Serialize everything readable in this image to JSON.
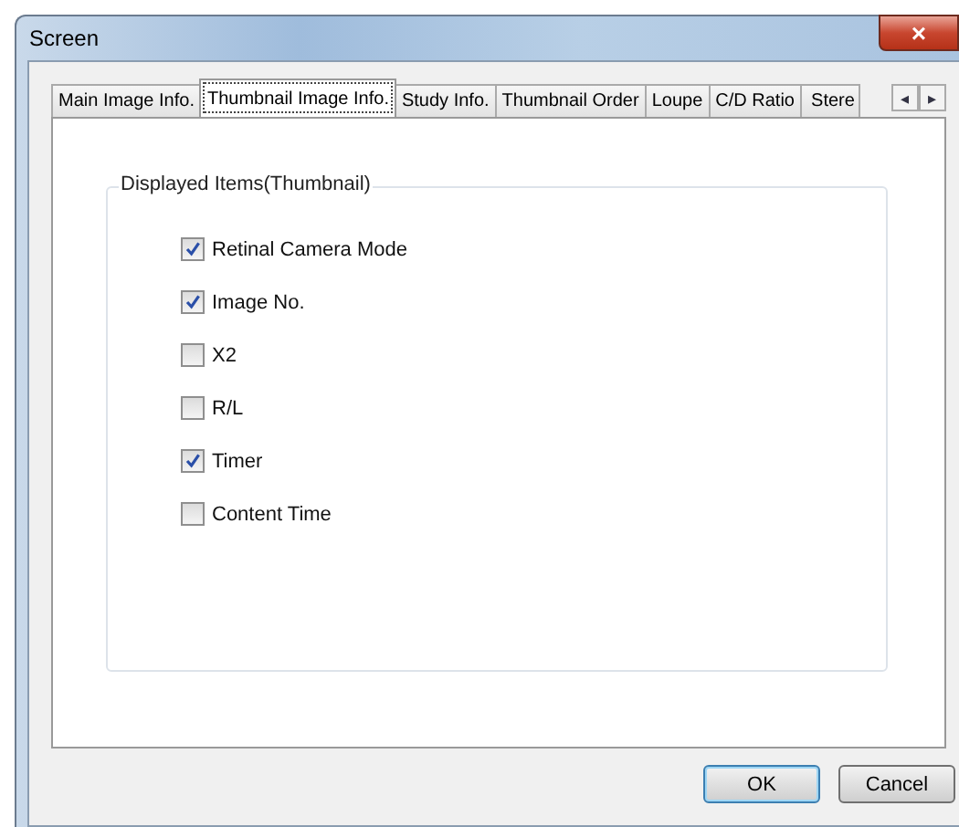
{
  "window": {
    "title": "Screen",
    "close": "×"
  },
  "tabs": [
    {
      "label": "Main Image Info.",
      "selected": false
    },
    {
      "label": "Thumbnail Image Info.",
      "selected": true
    },
    {
      "label": "Study Info.",
      "selected": false
    },
    {
      "label": "Thumbnail Order",
      "selected": false
    },
    {
      "label": "Loupe",
      "selected": false
    },
    {
      "label": "C/D Ratio",
      "selected": false
    },
    {
      "label": "Stere",
      "selected": false
    }
  ],
  "tab_scroll": {
    "left": "◂",
    "right": "▸"
  },
  "group": {
    "title": "Displayed Items(Thumbnail)",
    "items": [
      {
        "label": "Retinal Camera Mode",
        "checked": true
      },
      {
        "label": "Image No.",
        "checked": true
      },
      {
        "label": "X2",
        "checked": false
      },
      {
        "label": "R/L",
        "checked": false
      },
      {
        "label": "Timer",
        "checked": true
      },
      {
        "label": "Content Time",
        "checked": false
      }
    ]
  },
  "buttons": [
    {
      "label": "OK",
      "kind": "default"
    },
    {
      "label": "Cancel",
      "kind": "normal"
    }
  ]
}
